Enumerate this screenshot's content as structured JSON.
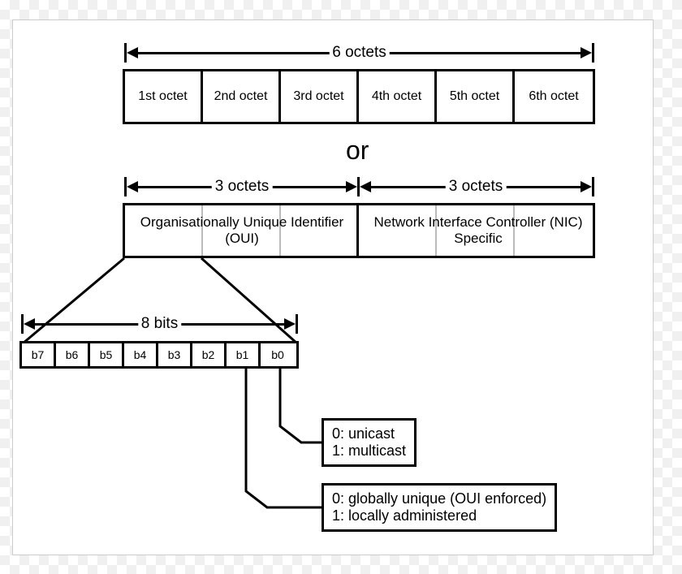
{
  "top_span_label": "6 octets",
  "octets": [
    "1st octet",
    "2nd octet",
    "3rd octet",
    "4th octet",
    "5th octet",
    "6th octet"
  ],
  "or_label": "or",
  "left_span_label": "3 octets",
  "right_span_label": "3 octets",
  "oui_label": "Organisationally Unique Identifier (OUI)",
  "nic_label": "Network Interface Controller (NIC) Specific",
  "bits_span_label": "8 bits",
  "bits": [
    "b7",
    "b6",
    "b5",
    "b4",
    "b3",
    "b2",
    "b1",
    "b0"
  ],
  "legend_b0_0": "0: unicast",
  "legend_b0_1": "1: multicast",
  "legend_b1_0": "0: globally unique (OUI enforced)",
  "legend_b1_1": "1: locally administered"
}
